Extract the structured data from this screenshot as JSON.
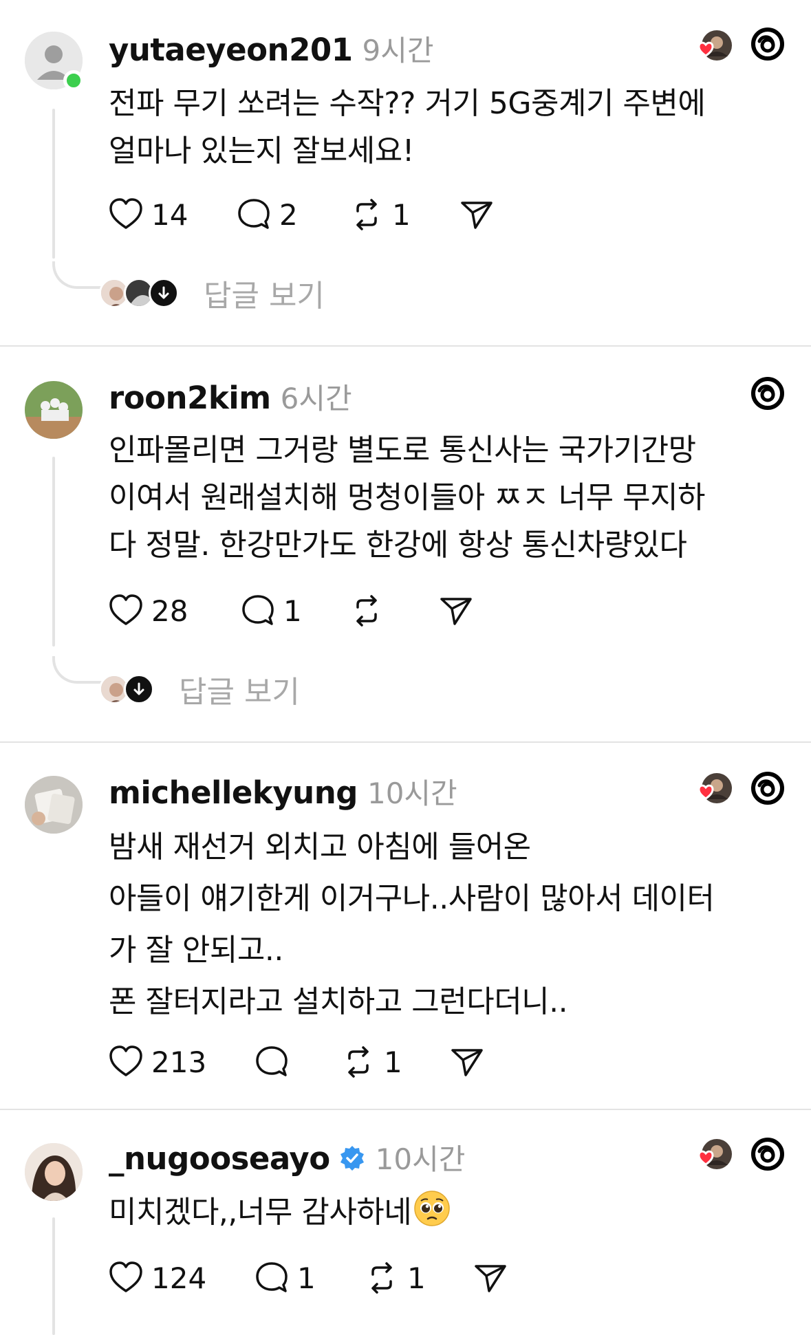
{
  "posts": [
    {
      "username": "yutaeyeon201",
      "time": "9시간",
      "lines": [
        "전파 무기 쏘려는 수작?? 거기 5G중계기 주변에",
        "얼마나 있는지 잘보세요!"
      ],
      "likes": "14",
      "comments": "2",
      "reposts": "1",
      "reply_label": "답글 보기"
    },
    {
      "username": "roon2kim",
      "time": "6시간",
      "lines": [
        "인파몰리면 그거랑 별도로  통신사는 국가기간망",
        "이여서 원래설치해 멍청이들아 ㅉㅈ 너무 무지하",
        "다 정말. 한강만가도 한강에 항상 통신차량있다"
      ],
      "likes": "28",
      "comments": "1",
      "reposts": "",
      "reply_label": "답글 보기"
    },
    {
      "username": "michellekyung",
      "time": "10시간",
      "lines": [
        "밤새 재선거 외치고 아침에 들어온",
        "아들이 얘기한게 이거구나..사람이 많아서 데이터",
        "가 잘 안되고..",
        "폰 잘터지라고 설치하고 그런다더니.."
      ],
      "likes": "213",
      "comments": "",
      "reposts": "1"
    },
    {
      "username": "_nugooseayo",
      "time": "10시간",
      "line": "미치겠다,,너무 감사하네",
      "likes": "124",
      "comments": "1",
      "reposts": "1"
    }
  ],
  "icons": {
    "like": "heart-icon",
    "comment": "comment-bubble-icon",
    "repost": "repost-icon",
    "share": "send-icon",
    "app": "threads-logo-icon",
    "verified": "verified-badge-icon"
  },
  "colors": {
    "liked_heart": "#ff3040",
    "online": "#3ccf4e",
    "verified": "#3897f0",
    "muted_text": "#9a9a9a"
  }
}
